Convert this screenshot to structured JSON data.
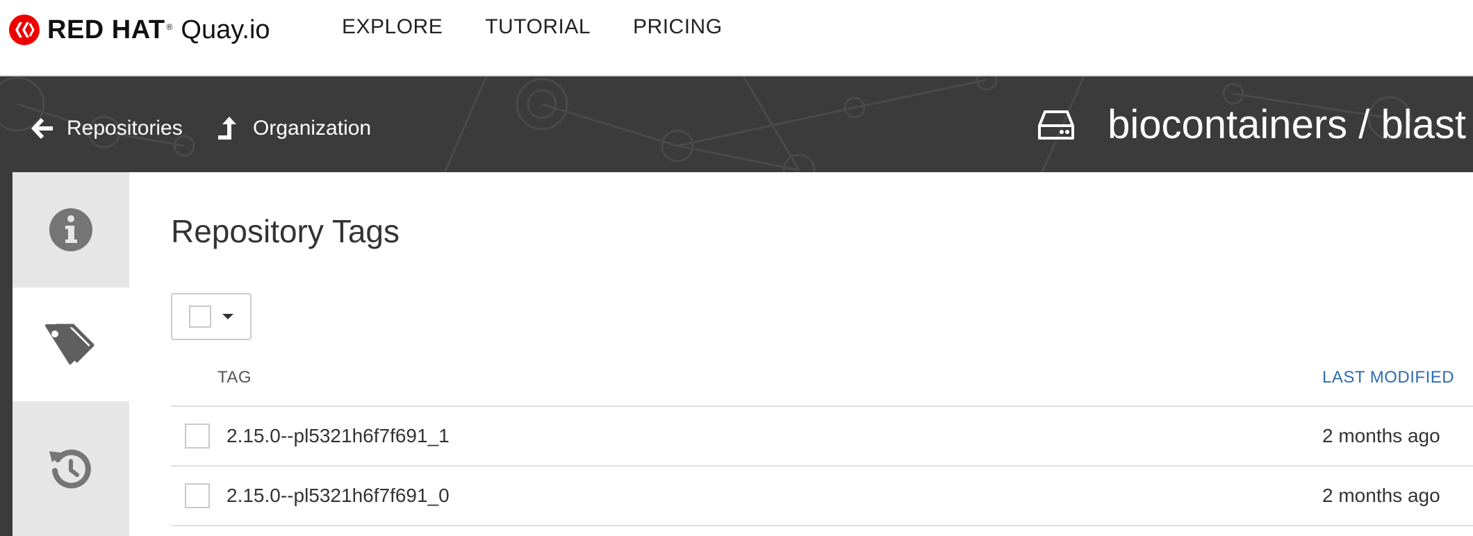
{
  "brand": {
    "name": "RED HAT",
    "registered": "®",
    "product": "Quay.io"
  },
  "nav": {
    "links": [
      "EXPLORE",
      "TUTORIAL",
      "PRICING"
    ]
  },
  "header": {
    "back_link": "Repositories",
    "org_link": "Organization",
    "repo_title": "biocontainers / blast"
  },
  "sidebar": {
    "tabs": [
      {
        "name": "info",
        "icon": "info-circle-icon",
        "active": false
      },
      {
        "name": "tags",
        "icon": "tags-icon",
        "active": true
      },
      {
        "name": "history",
        "icon": "history-icon",
        "active": false
      }
    ]
  },
  "main": {
    "title": "Repository Tags",
    "table": {
      "columns": [
        "TAG",
        "LAST MODIFIED"
      ],
      "rows": [
        {
          "tag": "2.15.0--pl5321h6f7f691_1",
          "modified": "2 months ago"
        },
        {
          "tag": "2.15.0--pl5321h6f7f691_0",
          "modified": "2 months ago"
        }
      ]
    }
  },
  "colors": {
    "header_bg": "#3b3b3b",
    "link_blue": "#2d6cb0",
    "brand_red": "#ee0000"
  }
}
